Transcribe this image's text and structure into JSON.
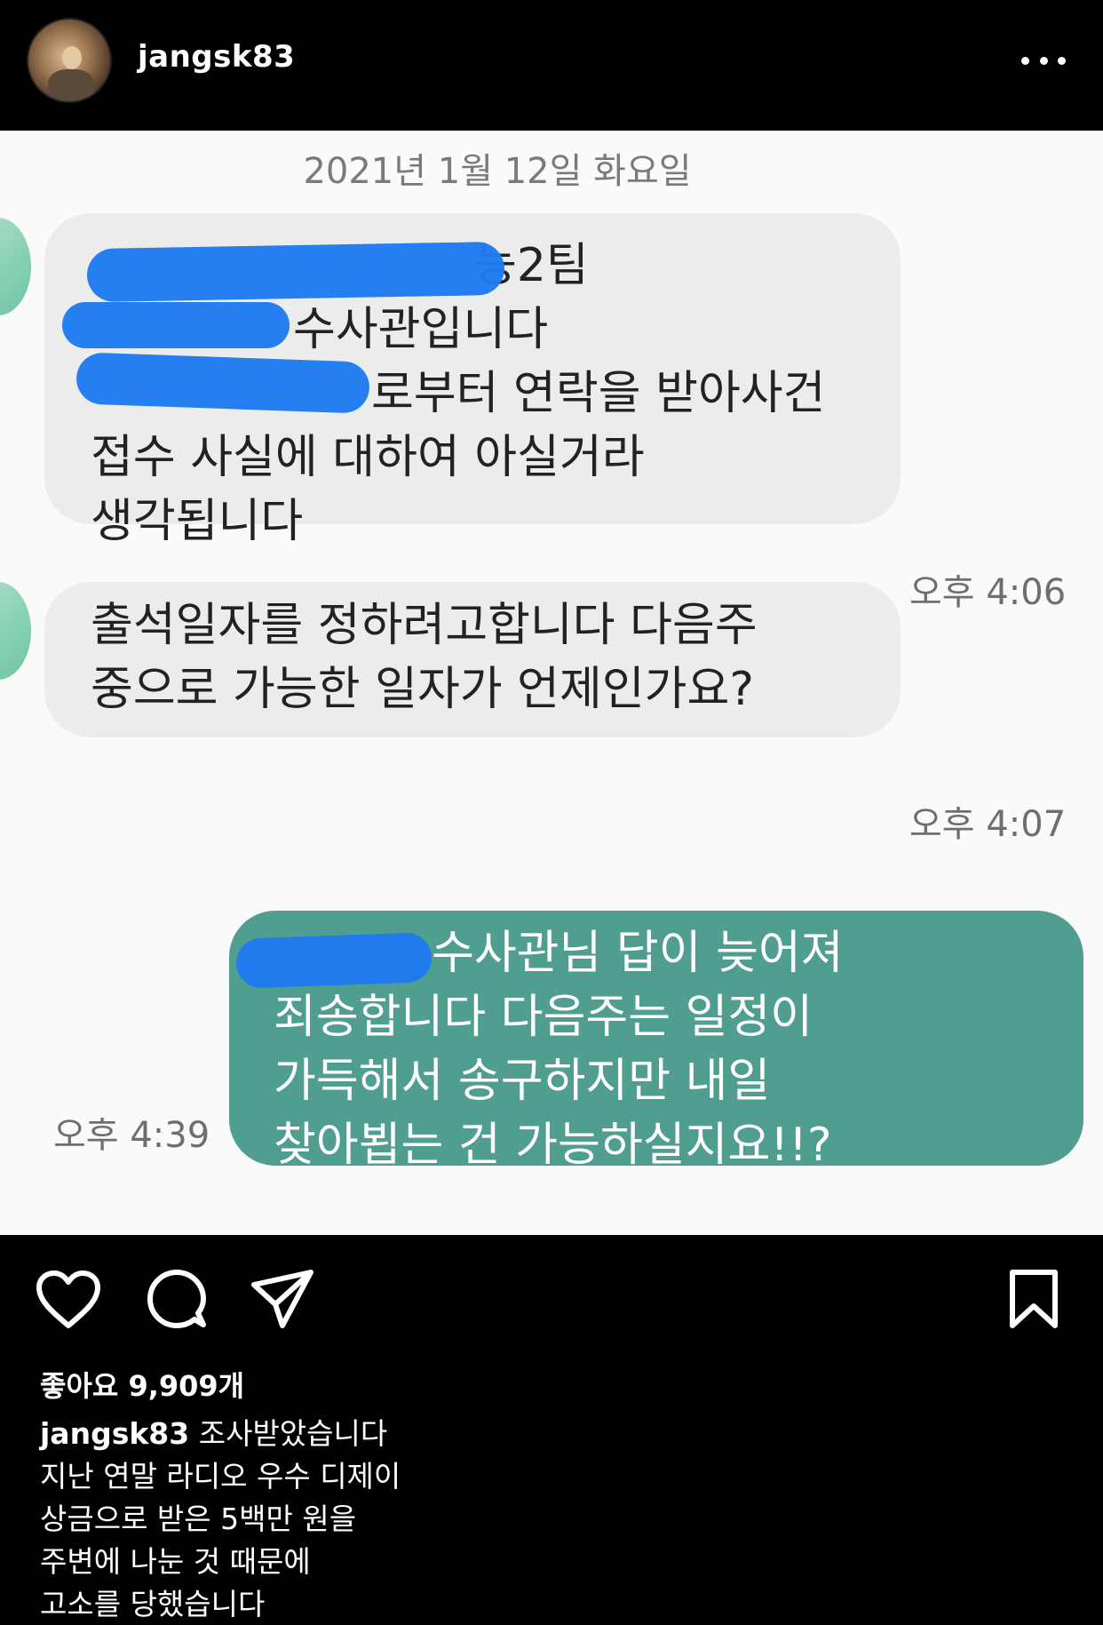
{
  "header": {
    "username": "jangsk83"
  },
  "chat": {
    "date": "2021년 1월 12일 화요일",
    "messages": [
      {
        "direction": "incoming",
        "lines": [
          "능2팀",
          "수사관입니다",
          "로부터 연락을 받아사건",
          "접수 사실에 대하여 아실거라",
          "생각됩니다"
        ],
        "time": "오후 4:06"
      },
      {
        "direction": "incoming",
        "lines": [
          "출석일자를 정하려고합니다 다음주",
          "중으로 가능한 일자가 언제인가요?"
        ],
        "time": "오후 4:07"
      },
      {
        "direction": "outgoing",
        "lines": [
          "수사관님 답이 늦어져",
          "죄송합니다 다음주는 일정이",
          "가득해서 송구하지만 내일",
          "찾아뵙는 건 가능하실지요!!?"
        ],
        "time": "오후 4:39"
      }
    ],
    "colors": {
      "incoming_bubble": "#ececec",
      "outgoing_bubble": "#4f9e8f",
      "redaction": "#1f7bf0"
    }
  },
  "post": {
    "likes": "좋아요 9,909개",
    "caption_user": "jangsk83",
    "caption_first": "조사받았습니다",
    "caption_lines": [
      "지난 연말 라디오 우수 디제이",
      "상금으로 받은 5백만 원을",
      "주변에 나눈 것 때문에",
      "고소를 당했습니다"
    ],
    "icons": [
      "heart-icon",
      "comment-icon",
      "share-icon",
      "bookmark-icon",
      "more-icon"
    ]
  }
}
